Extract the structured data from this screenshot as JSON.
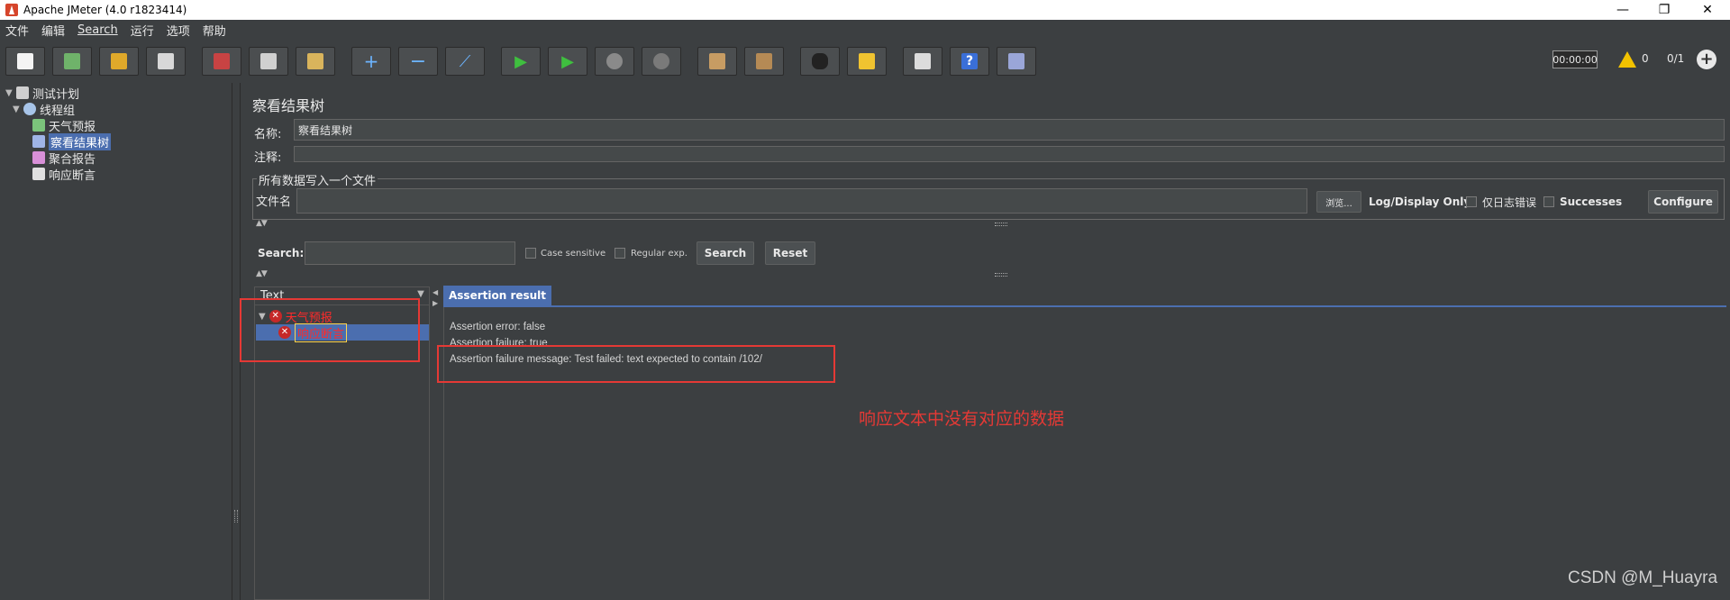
{
  "window": {
    "title": "Apache JMeter (4.0 r1823414)"
  },
  "menu": [
    "文件",
    "编辑",
    "Search",
    "运行",
    "选项",
    "帮助"
  ],
  "toolbar": {
    "timer": "00:00:00",
    "warn_count": "0",
    "threads": "0/1",
    "icons": [
      "new-icon",
      "templates-icon",
      "open-icon",
      "save-icon",
      "cut-icon",
      "copy-icon",
      "paste-icon",
      "expand-icon",
      "collapse-icon",
      "toggle-icon",
      "start-icon",
      "start-no-pause-icon",
      "stop-icon",
      "shutdown-icon",
      "clear-icon",
      "clear-all-icon",
      "search-icon",
      "reset-search-icon",
      "function-helper-icon",
      "help-icon",
      "remote-icon"
    ]
  },
  "tree": [
    {
      "label": "测试计划",
      "icon": "test-plan-icon",
      "level": 0
    },
    {
      "label": "线程组",
      "icon": "thread-group-icon",
      "level": 1
    },
    {
      "label": "天气预报",
      "icon": "sampler-icon",
      "level": 2
    },
    {
      "label": "察看结果树",
      "icon": "listener-icon",
      "level": 2,
      "selected": true
    },
    {
      "label": "聚合报告",
      "icon": "listener-icon",
      "level": 2
    },
    {
      "label": "响应断言",
      "icon": "assertion-icon",
      "level": 2
    }
  ],
  "panel": {
    "title": "察看结果树",
    "name_label": "名称:",
    "name_value": "察看结果树",
    "comment_label": "注释:",
    "comment_value": "",
    "file_group": "所有数据写入一个文件",
    "file_label": "文件名",
    "file_value": "",
    "browse_label": "浏览...",
    "log_display_label": "Log/Display Only:",
    "errors_label": "仅日志错误",
    "successes_label": "Successes",
    "configure_label": "Configure"
  },
  "search": {
    "label": "Search:",
    "value": "",
    "case_label": "Case sensitive",
    "regex_label": "Regular exp.",
    "search_btn": "Search",
    "reset_btn": "Reset"
  },
  "results": {
    "column": "Text",
    "nodes": [
      "天气预报",
      "响应断言"
    ],
    "tab": "Assertion result",
    "lines": [
      "Assertion error: false",
      "Assertion failure: true",
      "Assertion failure message: Test failed: text expected to contain /102/"
    ]
  },
  "annotation": {
    "note": "响应文本中没有对应的数据",
    "color": "#e53935"
  },
  "watermark": "CSDN @M_Huayra"
}
